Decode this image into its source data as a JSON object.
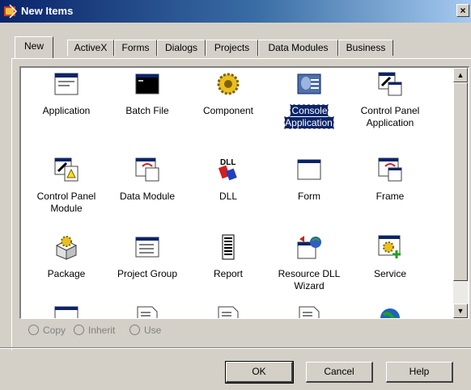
{
  "window": {
    "title": "New Items",
    "close_label": "×"
  },
  "tabs": [
    {
      "label": "New"
    },
    {
      "label": "ActiveX"
    },
    {
      "label": "Forms"
    },
    {
      "label": "Dialogs"
    },
    {
      "label": "Projects"
    },
    {
      "label": "Data Modules"
    },
    {
      "label": "Business"
    }
  ],
  "items": [
    {
      "label": "Application",
      "icon": "application-icon"
    },
    {
      "label": "Batch File",
      "icon": "batch-file-icon"
    },
    {
      "label": "Component",
      "icon": "component-icon"
    },
    {
      "label": "Console\nApplication",
      "icon": "console-application-icon",
      "selected": true
    },
    {
      "label": "Control Panel\nApplication",
      "icon": "control-panel-application-icon"
    },
    {
      "label": "Control Panel\nModule",
      "icon": "control-panel-module-icon"
    },
    {
      "label": "Data Module",
      "icon": "data-module-icon"
    },
    {
      "label": "DLL",
      "icon": "dll-icon"
    },
    {
      "label": "Form",
      "icon": "form-icon"
    },
    {
      "label": "Frame",
      "icon": "frame-icon"
    },
    {
      "label": "Package",
      "icon": "package-icon"
    },
    {
      "label": "Project Group",
      "icon": "project-group-icon"
    },
    {
      "label": "Report",
      "icon": "report-icon"
    },
    {
      "label": "Resource DLL\nWizard",
      "icon": "resource-dll-wizard-icon"
    },
    {
      "label": "Service",
      "icon": "service-icon"
    },
    {
      "label": "",
      "icon": "window-icon"
    },
    {
      "label": "",
      "icon": "document-icon"
    },
    {
      "label": "",
      "icon": "document-icon"
    },
    {
      "label": "",
      "icon": "document-icon"
    },
    {
      "label": "",
      "icon": "globe-icon"
    }
  ],
  "options": {
    "copy": "Copy",
    "inherit": "Inherit",
    "use": "Use"
  },
  "buttons": {
    "ok": "OK",
    "cancel": "Cancel",
    "help": "Help"
  },
  "colors": {
    "title_start": "#0a246a",
    "title_end": "#a6caf0",
    "selection": "#0a246a",
    "face": "#d4d0c8"
  }
}
